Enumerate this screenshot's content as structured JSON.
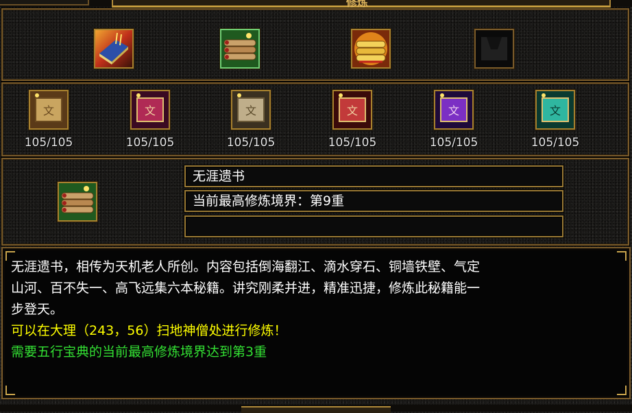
{
  "window": {
    "title": "修炼"
  },
  "books_row": [
    {
      "name": "book-1-icon",
      "selected": false
    },
    {
      "name": "book-2-icon",
      "selected": true
    },
    {
      "name": "book-3-icon",
      "selected": false
    },
    {
      "name": "empty-slot-icon",
      "selected": false
    }
  ],
  "scrolls_row": [
    {
      "name": "scroll-1-icon",
      "count": "105/105",
      "color": "#c9a560"
    },
    {
      "name": "scroll-2-icon",
      "count": "105/105",
      "color": "#b02a55"
    },
    {
      "name": "scroll-3-icon",
      "count": "105/105",
      "color": "#bfae8a"
    },
    {
      "name": "scroll-4-icon",
      "count": "105/105",
      "color": "#c23a3a"
    },
    {
      "name": "scroll-5-icon",
      "count": "105/105",
      "color": "#7b2fc4"
    },
    {
      "name": "scroll-6-icon",
      "count": "105/105",
      "color": "#2fb6a0"
    }
  ],
  "detail": {
    "book_name": "无涯遗书",
    "level_text": "当前最高修炼境界：第9重",
    "extra": ""
  },
  "description": {
    "lines_white": [
      "无涯遗书，相传为天机老人所创。内容包括倒海翻江、滴水穿石、铜墙铁壁、气定",
      "山河、百不失一、高飞远集六本秘籍。讲究刚柔并进，精准迅捷，修炼此秘籍能一",
      "步登天。"
    ],
    "line_yellow": "可以在大理（243，56）扫地神僧处进行修炼！",
    "line_green": "需要五行宝典的当前最高修炼境界达到第3重"
  },
  "colors": {
    "frame": "#7a5b2a",
    "gold": "#a7812f",
    "yellow_text": "#ffff00",
    "green_text": "#33e033"
  }
}
